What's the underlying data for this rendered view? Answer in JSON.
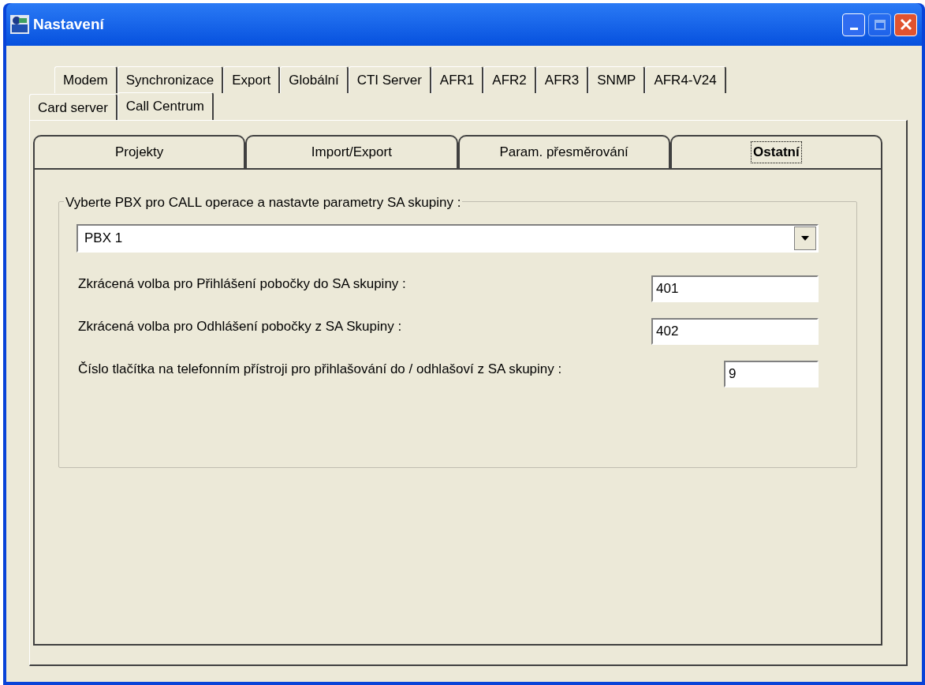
{
  "window": {
    "title": "Nastavení",
    "buttons": [
      {
        "kind": "minimize",
        "disabled": false
      },
      {
        "kind": "maximize",
        "disabled": true
      },
      {
        "kind": "close",
        "disabled": false
      }
    ]
  },
  "tab_rows": [
    {
      "tabs": [
        {
          "label": "Modem",
          "selected": false
        },
        {
          "label": "Synchronizace",
          "selected": false
        },
        {
          "label": "Export",
          "selected": false
        },
        {
          "label": "Globální",
          "selected": false
        },
        {
          "label": "CTI Server",
          "selected": false
        },
        {
          "label": "AFR1",
          "selected": false
        },
        {
          "label": "AFR2",
          "selected": false
        },
        {
          "label": "AFR3",
          "selected": false
        },
        {
          "label": "SNMP",
          "selected": false
        },
        {
          "label": "AFR4-V24",
          "selected": false
        }
      ]
    },
    {
      "tabs": [
        {
          "label": "Card server",
          "selected": false
        },
        {
          "label": "Call Centrum",
          "selected": true
        }
      ]
    }
  ],
  "sub_tabs": [
    {
      "label": "Projekty",
      "selected": false
    },
    {
      "label": "Import/Export",
      "selected": false
    },
    {
      "label": "Param. přesměrování",
      "selected": false
    },
    {
      "label": "Ostatní",
      "selected": true
    }
  ],
  "group": {
    "title": "Vyberte PBX pro CALL operace a nastavte parametry SA skupiny :",
    "pbx_select": {
      "value": "PBX 1"
    },
    "fields": [
      {
        "label": "Zkrácená volba pro Přihlášení pobočky do SA skupiny :",
        "value": "401",
        "kind": "wide"
      },
      {
        "label": "Zkrácená volba pro Odhlášení pobočky z SA Skupiny :",
        "value": "402",
        "kind": "wide"
      },
      {
        "label": "Číslo tlačítka na telefonním přístroji pro přihlašování do / odhlašoví z SA skupiny :",
        "value": "9",
        "kind": "narrow"
      }
    ]
  }
}
